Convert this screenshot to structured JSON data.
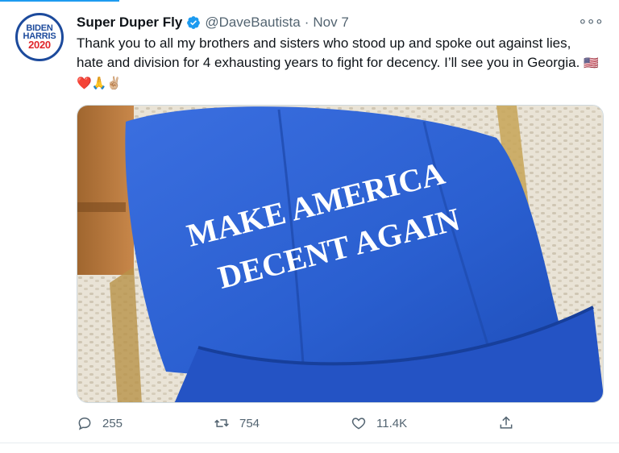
{
  "avatar": {
    "line1": "BIDEN",
    "line2": "HARRIS",
    "line3": "2020"
  },
  "tweet": {
    "author_name": "Super Duper Fly",
    "handle": "@DaveBautista",
    "separator": "·",
    "date": "Nov 7",
    "text": "Thank you to all my brothers and sisters who stood up and spoke out against lies, hate and division for 4 exhausting years to fight for decency. I’ll see you in Georgia. ",
    "emoji": "🇺🇸❤️🙏✌🏼",
    "more_label": "∘∘∘"
  },
  "media": {
    "cap_text_line1": "MAKE AMERICA",
    "cap_text_line2": "DECENT AGAIN",
    "cap_color": "#2a5fd0"
  },
  "actions": {
    "reply_count": "255",
    "retweet_count": "754",
    "like_count": "11.4K"
  },
  "colors": {
    "accent": "#1d9bf0",
    "secondary_text": "#536471"
  }
}
